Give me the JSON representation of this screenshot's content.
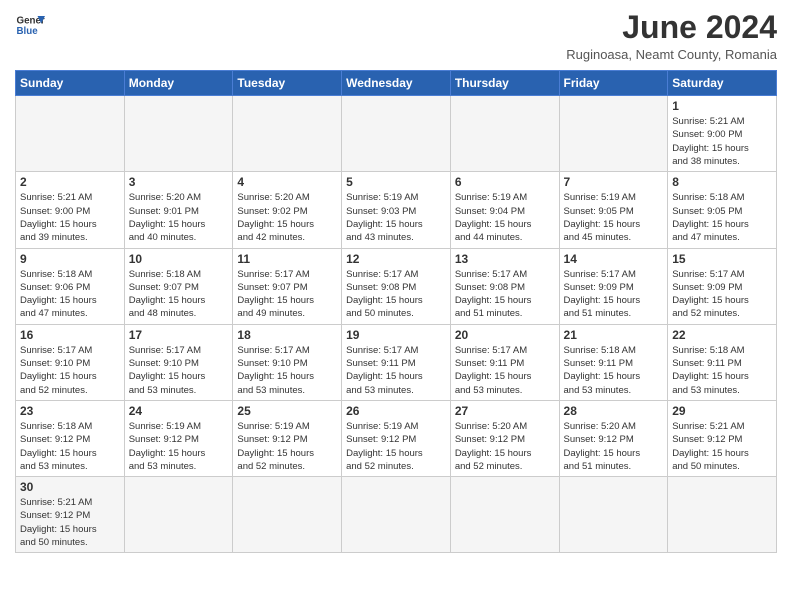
{
  "header": {
    "logo_general": "General",
    "logo_blue": "Blue",
    "month_year": "June 2024",
    "location": "Ruginoasa, Neamt County, Romania"
  },
  "weekdays": [
    "Sunday",
    "Monday",
    "Tuesday",
    "Wednesday",
    "Thursday",
    "Friday",
    "Saturday"
  ],
  "weeks": [
    [
      {
        "day": "",
        "info": ""
      },
      {
        "day": "",
        "info": ""
      },
      {
        "day": "",
        "info": ""
      },
      {
        "day": "",
        "info": ""
      },
      {
        "day": "",
        "info": ""
      },
      {
        "day": "",
        "info": ""
      },
      {
        "day": "1",
        "info": "Sunrise: 5:21 AM\nSunset: 9:00 PM\nDaylight: 15 hours\nand 38 minutes."
      }
    ],
    [
      {
        "day": "2",
        "info": "Sunrise: 5:21 AM\nSunset: 9:00 PM\nDaylight: 15 hours\nand 39 minutes."
      },
      {
        "day": "3",
        "info": "Sunrise: 5:20 AM\nSunset: 9:01 PM\nDaylight: 15 hours\nand 40 minutes."
      },
      {
        "day": "4",
        "info": "Sunrise: 5:20 AM\nSunset: 9:02 PM\nDaylight: 15 hours\nand 42 minutes."
      },
      {
        "day": "5",
        "info": "Sunrise: 5:19 AM\nSunset: 9:03 PM\nDaylight: 15 hours\nand 43 minutes."
      },
      {
        "day": "6",
        "info": "Sunrise: 5:19 AM\nSunset: 9:04 PM\nDaylight: 15 hours\nand 44 minutes."
      },
      {
        "day": "7",
        "info": "Sunrise: 5:19 AM\nSunset: 9:05 PM\nDaylight: 15 hours\nand 45 minutes."
      },
      {
        "day": "8",
        "info": "Sunrise: 5:18 AM\nSunset: 9:05 PM\nDaylight: 15 hours\nand 47 minutes."
      }
    ],
    [
      {
        "day": "9",
        "info": "Sunrise: 5:18 AM\nSunset: 9:06 PM\nDaylight: 15 hours\nand 47 minutes."
      },
      {
        "day": "10",
        "info": "Sunrise: 5:18 AM\nSunset: 9:07 PM\nDaylight: 15 hours\nand 48 minutes."
      },
      {
        "day": "11",
        "info": "Sunrise: 5:17 AM\nSunset: 9:07 PM\nDaylight: 15 hours\nand 49 minutes."
      },
      {
        "day": "12",
        "info": "Sunrise: 5:17 AM\nSunset: 9:08 PM\nDaylight: 15 hours\nand 50 minutes."
      },
      {
        "day": "13",
        "info": "Sunrise: 5:17 AM\nSunset: 9:08 PM\nDaylight: 15 hours\nand 51 minutes."
      },
      {
        "day": "14",
        "info": "Sunrise: 5:17 AM\nSunset: 9:09 PM\nDaylight: 15 hours\nand 51 minutes."
      },
      {
        "day": "15",
        "info": "Sunrise: 5:17 AM\nSunset: 9:09 PM\nDaylight: 15 hours\nand 52 minutes."
      }
    ],
    [
      {
        "day": "16",
        "info": "Sunrise: 5:17 AM\nSunset: 9:10 PM\nDaylight: 15 hours\nand 52 minutes."
      },
      {
        "day": "17",
        "info": "Sunrise: 5:17 AM\nSunset: 9:10 PM\nDaylight: 15 hours\nand 53 minutes."
      },
      {
        "day": "18",
        "info": "Sunrise: 5:17 AM\nSunset: 9:10 PM\nDaylight: 15 hours\nand 53 minutes."
      },
      {
        "day": "19",
        "info": "Sunrise: 5:17 AM\nSunset: 9:11 PM\nDaylight: 15 hours\nand 53 minutes."
      },
      {
        "day": "20",
        "info": "Sunrise: 5:17 AM\nSunset: 9:11 PM\nDaylight: 15 hours\nand 53 minutes."
      },
      {
        "day": "21",
        "info": "Sunrise: 5:18 AM\nSunset: 9:11 PM\nDaylight: 15 hours\nand 53 minutes."
      },
      {
        "day": "22",
        "info": "Sunrise: 5:18 AM\nSunset: 9:11 PM\nDaylight: 15 hours\nand 53 minutes."
      }
    ],
    [
      {
        "day": "23",
        "info": "Sunrise: 5:18 AM\nSunset: 9:12 PM\nDaylight: 15 hours\nand 53 minutes."
      },
      {
        "day": "24",
        "info": "Sunrise: 5:19 AM\nSunset: 9:12 PM\nDaylight: 15 hours\nand 53 minutes."
      },
      {
        "day": "25",
        "info": "Sunrise: 5:19 AM\nSunset: 9:12 PM\nDaylight: 15 hours\nand 52 minutes."
      },
      {
        "day": "26",
        "info": "Sunrise: 5:19 AM\nSunset: 9:12 PM\nDaylight: 15 hours\nand 52 minutes."
      },
      {
        "day": "27",
        "info": "Sunrise: 5:20 AM\nSunset: 9:12 PM\nDaylight: 15 hours\nand 52 minutes."
      },
      {
        "day": "28",
        "info": "Sunrise: 5:20 AM\nSunset: 9:12 PM\nDaylight: 15 hours\nand 51 minutes."
      },
      {
        "day": "29",
        "info": "Sunrise: 5:21 AM\nSunset: 9:12 PM\nDaylight: 15 hours\nand 50 minutes."
      }
    ],
    [
      {
        "day": "30",
        "info": "Sunrise: 5:21 AM\nSunset: 9:12 PM\nDaylight: 15 hours\nand 50 minutes."
      },
      {
        "day": "",
        "info": ""
      },
      {
        "day": "",
        "info": ""
      },
      {
        "day": "",
        "info": ""
      },
      {
        "day": "",
        "info": ""
      },
      {
        "day": "",
        "info": ""
      },
      {
        "day": "",
        "info": ""
      }
    ]
  ]
}
